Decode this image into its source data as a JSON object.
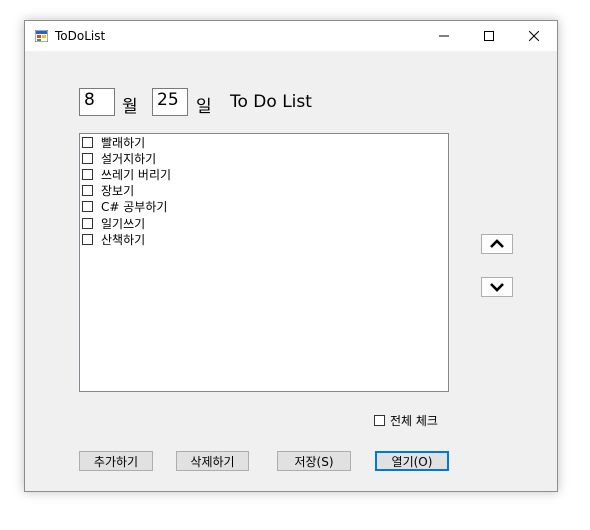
{
  "window": {
    "title": "ToDoList"
  },
  "titlebar": {
    "min_icon": "minimize-icon",
    "max_icon": "maximize-icon",
    "close_icon": "close-icon"
  },
  "date": {
    "month": "8",
    "month_label": "월",
    "day": "25",
    "day_label": "일",
    "heading": "To Do List"
  },
  "todo_items": [
    {
      "label": "빨래하기",
      "checked": false
    },
    {
      "label": "설거지하기",
      "checked": false
    },
    {
      "label": "쓰레기 버리기",
      "checked": false
    },
    {
      "label": "장보기",
      "checked": false
    },
    {
      "label": "C# 공부하기",
      "checked": false
    },
    {
      "label": "일기쓰기",
      "checked": false
    },
    {
      "label": "산책하기",
      "checked": false
    }
  ],
  "move": {
    "up_icon": "chevron-up-icon",
    "down_icon": "chevron-down-icon"
  },
  "check_all": {
    "label": "전체 체크",
    "checked": false
  },
  "buttons": {
    "add": "추가하기",
    "delete": "삭제하기",
    "save": "저장(S)",
    "open": "열기(O)"
  },
  "colors": {
    "focus_border": "#0078d7",
    "window_bg": "#f0f0f0"
  }
}
